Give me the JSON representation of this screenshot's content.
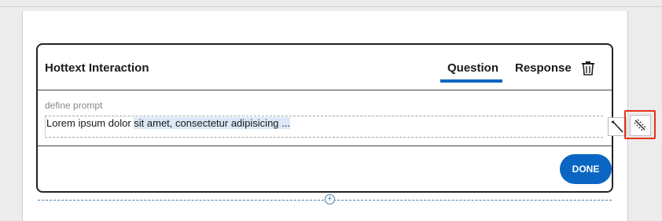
{
  "card": {
    "title": "Hottext Interaction",
    "tabs": {
      "question": "Question",
      "response": "Response"
    },
    "trash_icon": "trash-icon"
  },
  "prompt": {
    "label": "define prompt",
    "text_plain": "Lorem ipsum dolor ",
    "text_selected": "sit amet, consectetur adipisicing ..."
  },
  "toolbar": {
    "tool1_icon": "magic-wand-icon",
    "tool2_icon": "hottext-icon"
  },
  "actions": {
    "done_label": "DONE"
  },
  "insert": {
    "icon": "plus-circle-icon",
    "symbol": "+"
  },
  "colors": {
    "accent": "#0b66c3",
    "highlight": "#e8301c"
  }
}
